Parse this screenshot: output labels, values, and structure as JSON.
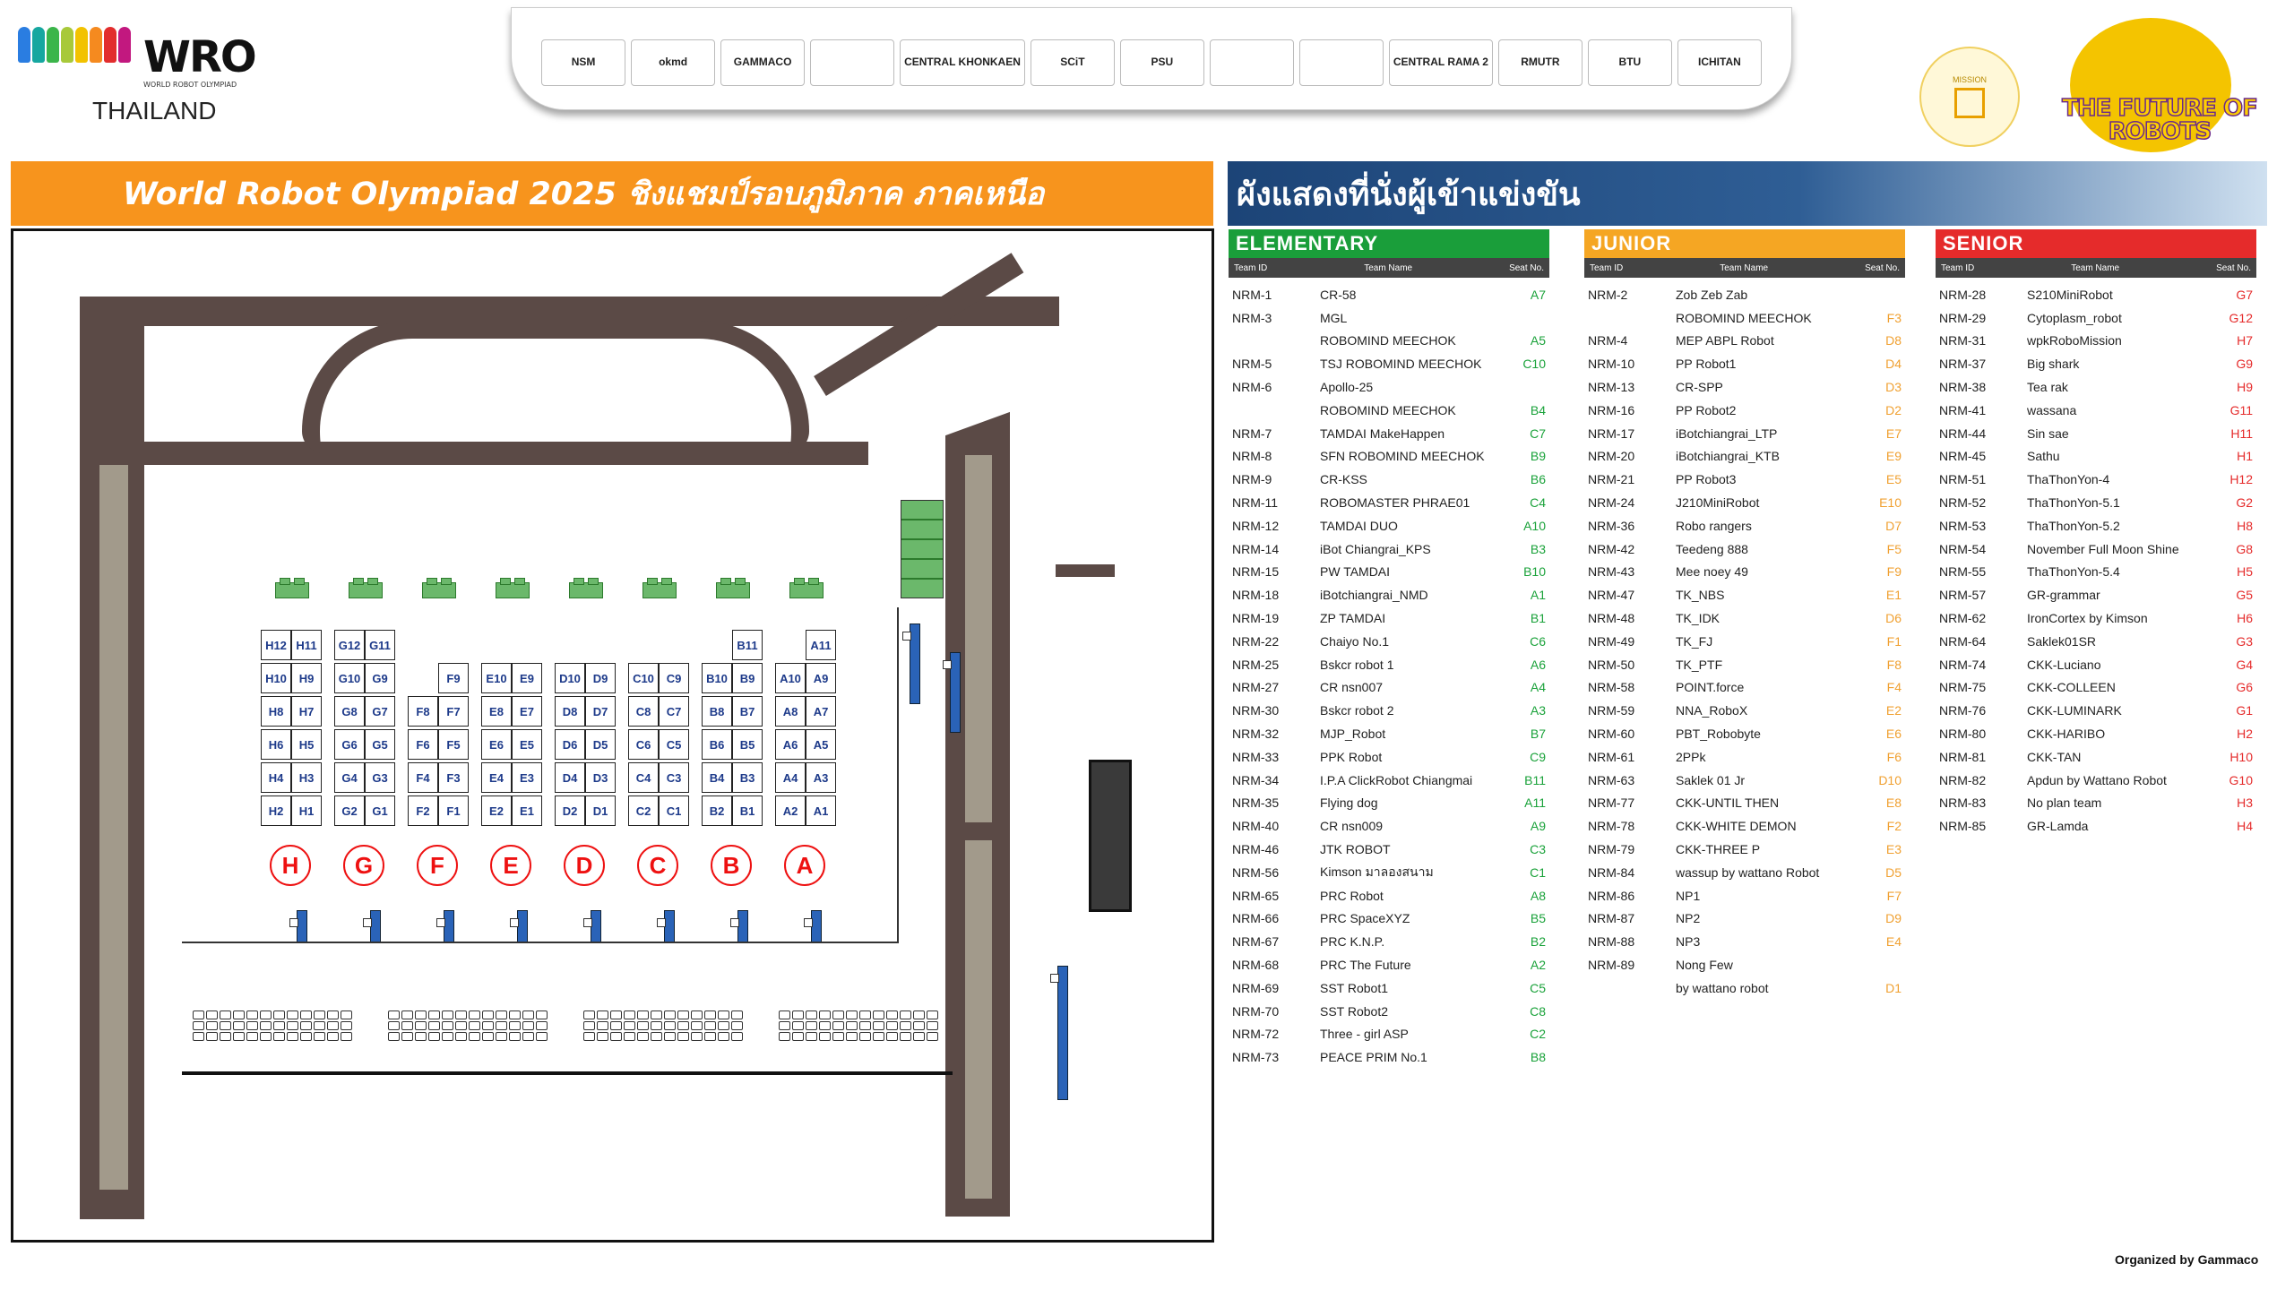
{
  "brand": {
    "wro_text": "WRO",
    "wro_small": "WORLD ROBOT OLYMPIAD",
    "region": "THAILAND"
  },
  "sponsors": [
    "NSM",
    "okmd",
    "GAMMACO",
    "",
    "CENTRAL KHONKAEN",
    "SCiT",
    "PSU",
    "",
    "",
    "CENTRAL RAMA 2",
    "RMUTR",
    "BTU",
    "ICHITAN"
  ],
  "mission_label": "MISSION",
  "future_text": "THE FUTURE OF ROBOTS",
  "title_left": "World Robot Olympiad 2025 ชิงแชมป์รอบภูมิภาค ภาคเหนือ",
  "title_right": "ผังแสดงที่นั่งผู้เข้าแข่งขัน",
  "table_headers": {
    "id": "Team ID",
    "name": "Team Name",
    "seat": "Seat No."
  },
  "zones": [
    "H",
    "G",
    "F",
    "E",
    "D",
    "C",
    "B",
    "A"
  ],
  "columns": [
    {
      "key": "elementary",
      "title": "ELEMENTARY",
      "color": "#1a9e3a",
      "seat_color": "#1aa23a",
      "rows": [
        [
          "NRM-1",
          "CR-58",
          "A7"
        ],
        [
          "NRM-3",
          "MGL",
          ""
        ],
        [
          "",
          "ROBOMIND MEECHOK",
          "A5"
        ],
        [
          "NRM-5",
          "TSJ ROBOMIND MEECHOK",
          "C10"
        ],
        [
          "NRM-6",
          "Apollo-25",
          ""
        ],
        [
          "",
          "ROBOMIND MEECHOK",
          "B4"
        ],
        [
          "NRM-7",
          "TAMDAI MakeHappen",
          "C7"
        ],
        [
          "NRM-8",
          "SFN ROBOMIND MEECHOK",
          "B9"
        ],
        [
          "NRM-9",
          "CR-KSS",
          "B6"
        ],
        [
          "NRM-11",
          "ROBOMASTER PHRAE01",
          "C4"
        ],
        [
          "NRM-12",
          "TAMDAI DUO",
          "A10"
        ],
        [
          "NRM-14",
          "iBot Chiangrai_KPS",
          "B3"
        ],
        [
          "NRM-15",
          "PW TAMDAI",
          "B10"
        ],
        [
          "NRM-18",
          "iBotchiangrai_NMD",
          "A1"
        ],
        [
          "NRM-19",
          "ZP TAMDAI",
          "B1"
        ],
        [
          "NRM-22",
          "Chaiyo No.1",
          "C6"
        ],
        [
          "NRM-25",
          "Bskcr robot 1",
          "A6"
        ],
        [
          "NRM-27",
          "CR nsn007",
          "A4"
        ],
        [
          "NRM-30",
          "Bskcr robot 2",
          "A3"
        ],
        [
          "NRM-32",
          "MJP_Robot",
          "B7"
        ],
        [
          "NRM-33",
          "PPK Robot",
          "C9"
        ],
        [
          "NRM-34",
          "I.P.A ClickRobot Chiangmai",
          "B11"
        ],
        [
          "NRM-35",
          "Flying dog",
          "A11"
        ],
        [
          "NRM-40",
          "CR nsn009",
          "A9"
        ],
        [
          "NRM-46",
          "JTK ROBOT",
          "C3"
        ],
        [
          "NRM-56",
          "Kimson มาลองสนาม",
          "C1"
        ],
        [
          "NRM-65",
          "PRC Robot",
          "A8"
        ],
        [
          "NRM-66",
          "PRC SpaceXYZ",
          "B5"
        ],
        [
          "NRM-67",
          "PRC K.N.P.",
          "B2"
        ],
        [
          "NRM-68",
          "PRC The Future",
          "A2"
        ],
        [
          "NRM-69",
          "SST Robot1",
          "C5"
        ],
        [
          "NRM-70",
          "SST Robot2",
          "C8"
        ],
        [
          "NRM-72",
          "Three - girl ASP",
          "C2"
        ],
        [
          "NRM-73",
          "PEACE PRIM No.1",
          "B8"
        ]
      ]
    },
    {
      "key": "junior",
      "title": "JUNIOR",
      "color": "#f5a623",
      "seat_color": "#f0a030",
      "rows": [
        [
          "NRM-2",
          "Zob Zeb Zab",
          ""
        ],
        [
          "",
          "ROBOMIND MEECHOK",
          "F3"
        ],
        [
          "NRM-4",
          "MEP ABPL Robot",
          "D8"
        ],
        [
          "NRM-10",
          "PP Robot1",
          "D4"
        ],
        [
          "NRM-13",
          "CR-SPP",
          "D3"
        ],
        [
          "NRM-16",
          "PP Robot2",
          "D2"
        ],
        [
          "NRM-17",
          "iBotchiangrai_LTP",
          "E7"
        ],
        [
          "NRM-20",
          "iBotchiangrai_KTB",
          "E9"
        ],
        [
          "NRM-21",
          "PP Robot3",
          "E5"
        ],
        [
          "NRM-24",
          "J210MiniRobot",
          "E10"
        ],
        [
          "NRM-36",
          "Robo rangers",
          "D7"
        ],
        [
          "NRM-42",
          "Teedeng 888",
          "F5"
        ],
        [
          "NRM-43",
          "Mee noey 49",
          "F9"
        ],
        [
          "NRM-47",
          "TK_NBS",
          "E1"
        ],
        [
          "NRM-48",
          "TK_IDK",
          "D6"
        ],
        [
          "NRM-49",
          "TK_FJ",
          "F1"
        ],
        [
          "NRM-50",
          "TK_PTF",
          "F8"
        ],
        [
          "NRM-58",
          "POINT.force",
          "F4"
        ],
        [
          "NRM-59",
          "NNA_RoboX",
          "E2"
        ],
        [
          "NRM-60",
          "PBT_Robobyte",
          "E6"
        ],
        [
          "NRM-61",
          "2PPk",
          "F6"
        ],
        [
          "NRM-63",
          "Saklek 01 Jr",
          "D10"
        ],
        [
          "NRM-77",
          "CKK-UNTIL THEN",
          "E8"
        ],
        [
          "NRM-78",
          "CKK-WHITE DEMON",
          "F2"
        ],
        [
          "NRM-79",
          "CKK-THREE P",
          "E3"
        ],
        [
          "NRM-84",
          "wassup by wattano Robot",
          "D5"
        ],
        [
          "NRM-86",
          "NP1",
          "F7"
        ],
        [
          "NRM-87",
          "NP2",
          "D9"
        ],
        [
          "NRM-88",
          "NP3",
          "E4"
        ],
        [
          "NRM-89",
          "Nong Few",
          ""
        ],
        [
          "",
          "by wattano robot",
          "D1"
        ]
      ]
    },
    {
      "key": "senior",
      "title": "SENIOR",
      "color": "#e52b2b",
      "seat_color": "#e52b2b",
      "rows": [
        [
          "NRM-28",
          "S210MiniRobot",
          "G7"
        ],
        [
          "NRM-29",
          "Cytoplasm_robot",
          "G12"
        ],
        [
          "NRM-31",
          "wpkRoboMission",
          "H7"
        ],
        [
          "NRM-37",
          "Big shark",
          "G9"
        ],
        [
          "NRM-38",
          "Tea rak",
          "H9"
        ],
        [
          "NRM-41",
          "wassana",
          "G11"
        ],
        [
          "NRM-44",
          "Sin sae",
          "H11"
        ],
        [
          "NRM-45",
          "Sathu",
          "H1"
        ],
        [
          "NRM-51",
          "ThaThonYon-4",
          "H12"
        ],
        [
          "NRM-52",
          "ThaThonYon-5.1",
          "G2"
        ],
        [
          "NRM-53",
          "ThaThonYon-5.2",
          "H8"
        ],
        [
          "NRM-54",
          "November Full Moon Shine",
          "G8"
        ],
        [
          "NRM-55",
          "ThaThonYon-5.4",
          "H5"
        ],
        [
          "NRM-57",
          "GR-grammar",
          "G5"
        ],
        [
          "NRM-62",
          "IronCortex by Kimson",
          "H6"
        ],
        [
          "NRM-64",
          "Saklek01SR",
          "G3"
        ],
        [
          "NRM-74",
          "CKK-Luciano",
          "G4"
        ],
        [
          "NRM-75",
          "CKK-COLLEEN",
          "G6"
        ],
        [
          "NRM-76",
          "CKK-LUMINARK",
          "G1"
        ],
        [
          "NRM-80",
          "CKK-HARIBO",
          "H2"
        ],
        [
          "NRM-81",
          "CKK-TAN",
          "H10"
        ],
        [
          "NRM-82",
          "Apdun by Wattano Robot",
          "G10"
        ],
        [
          "NRM-83",
          "No plan team",
          "H3"
        ],
        [
          "NRM-85",
          "GR-Lamda",
          "H4"
        ]
      ]
    }
  ],
  "organized_by": "Organized by Gammaco"
}
